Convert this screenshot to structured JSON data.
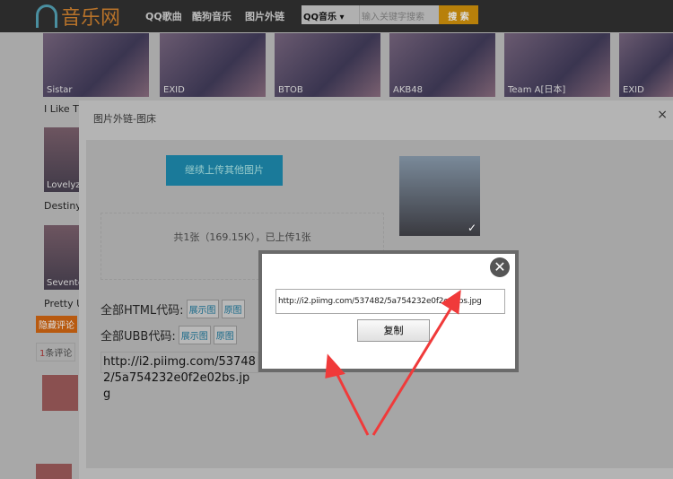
{
  "header": {
    "logo": "音乐网",
    "nav": [
      "QQ歌曲",
      "酷狗音乐",
      "图片外链"
    ],
    "search_select": "QQ音乐",
    "search_placeholder": "输入关键字搜索",
    "search_button": "搜 索"
  },
  "thumbnails": [
    "Sistar",
    "EXID",
    "BTOB",
    "AKB48",
    "Team A[日本]",
    "EXID"
  ],
  "sidebar": {
    "items": [
      {
        "label": "Lovelyz",
        "title": "Destiny"
      },
      {
        "label": "Seventeen",
        "title": "Pretty U"
      }
    ],
    "first_title": "I Like That",
    "hide_comments": "隐藏评论",
    "comment_count": "1",
    "comment_label": "条评论"
  },
  "dialog": {
    "title": "图片外链-图床",
    "close": "×",
    "upload_button": "继续上传其他图片",
    "status": "共1张（169.15K），已上传1张",
    "html_label": "全部HTML代码:",
    "ubb_label": "全部UBB代码:",
    "btn_show": "展示图",
    "btn_orig": "原图",
    "url": "http://i2.piimg.com/537482/5a754232e0f2e02bs.jpg",
    "check": "✓"
  },
  "popup": {
    "url": "http://i2.piimg.com/537482/5a754232e0f2e02bs.jpg",
    "copy_button": "复制",
    "close": "✕"
  }
}
